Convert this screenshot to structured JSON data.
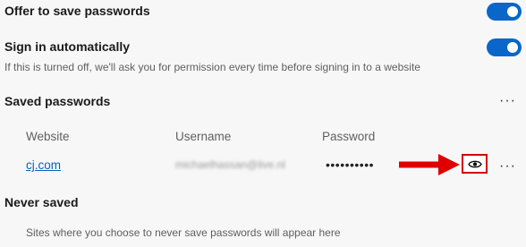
{
  "settings": {
    "offer_save": {
      "label": "Offer to save passwords",
      "enabled": true
    },
    "sign_in_auto": {
      "label": "Sign in automatically",
      "enabled": true,
      "description": "If this is turned off, we'll ask you for permission every time before signing in to a website"
    }
  },
  "saved_passwords": {
    "title": "Saved passwords",
    "more_label": "···",
    "columns": {
      "website": "Website",
      "username": "Username",
      "password": "Password"
    },
    "entries": [
      {
        "website": "cj.com",
        "username": "michaelhassan@live.nl",
        "password": "••••••••••"
      }
    ],
    "reveal_icon": "eye-icon"
  },
  "never_saved": {
    "title": "Never saved",
    "description": "Sites where you choose to never save passwords will appear here"
  },
  "colors": {
    "accent": "#0a66c9",
    "highlight": "#d40000"
  }
}
